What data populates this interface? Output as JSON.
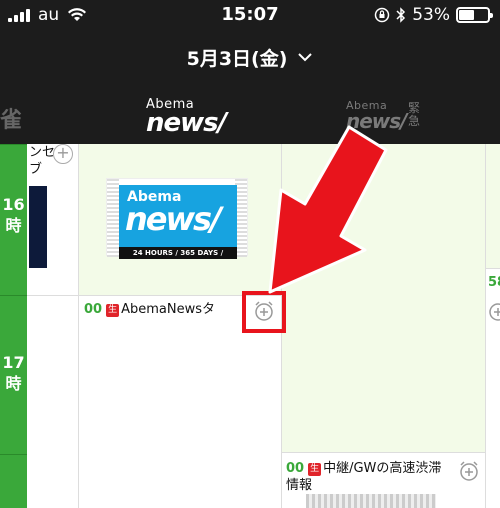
{
  "status_bar": {
    "carrier": "au",
    "time": "15:07",
    "battery_percent": "53%",
    "battery_level": 0.53
  },
  "date_header": {
    "date": "5月3日(金)"
  },
  "channels": {
    "left_partial": "雀",
    "active": {
      "top": "Abema",
      "bottom": "news/"
    },
    "next": {
      "top": "Abema",
      "bottom": "news/",
      "suffix": "緊急"
    }
  },
  "timeline": {
    "hours": [
      "16\n時",
      "17\n時"
    ]
  },
  "programs": {
    "left_partial_title": "ンセ\nブ",
    "abema_news": {
      "minute": "00",
      "badge": "生",
      "title": "AbemaNewsタ"
    },
    "abema_thumb": {
      "top": "Abema",
      "bottom": "news/",
      "strip": "24 HOURS / 365 DAYS /"
    },
    "traffic": {
      "minute": "00",
      "badge": "生",
      "title": "生中継/GWの高速渋滞\n情報",
      "title_line1": "中継/GWの高速渋滞",
      "title_line2": "情報"
    },
    "right_partial_minute": "58"
  },
  "colors": {
    "accent_green": "#3aa83a",
    "highlight_red": "#e8141c",
    "live_red": "#e0242a"
  }
}
